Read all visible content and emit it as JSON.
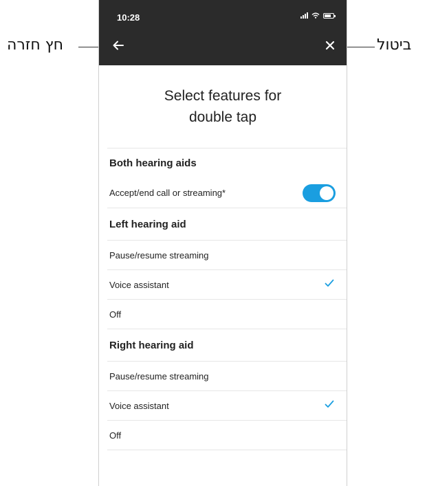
{
  "annotations": {
    "back_label": "חץ חזרה",
    "cancel_label": "ביטול"
  },
  "status_bar": {
    "time": "10:28"
  },
  "screen": {
    "title_line1": "Select features for",
    "title_line2": "double tap"
  },
  "sections": {
    "both": {
      "title": "Both hearing aids",
      "item_label": "Accept/end call or streaming*",
      "toggle_on": true
    },
    "left": {
      "title": "Left hearing aid",
      "options": [
        "Pause/resume streaming",
        "Voice assistant",
        "Off"
      ],
      "selected": "Voice assistant"
    },
    "right": {
      "title": "Right hearing aid",
      "options": [
        "Pause/resume streaming",
        "Voice assistant",
        "Off"
      ],
      "selected": "Voice assistant"
    }
  },
  "colors": {
    "accent": "#1a9ee0",
    "topbar": "#2b2b2b"
  }
}
